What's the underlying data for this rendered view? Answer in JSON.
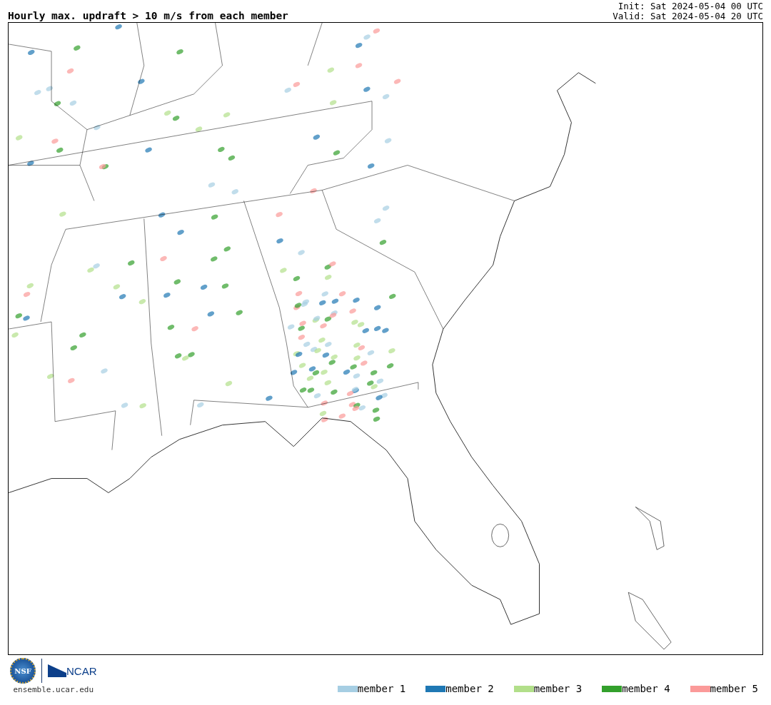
{
  "title": "Hourly max. updraft > 10 m/s from each member",
  "init": "Init: Sat 2024-05-04 00 UTC",
  "valid": "Valid: Sat 2024-05-04 20 UTC",
  "logos": {
    "nsf": "NSF",
    "ncar": "NCAR",
    "url": "ensemble.ucar.edu"
  },
  "legend": [
    {
      "label": "member 1",
      "color": "#a6cee3"
    },
    {
      "label": "member 2",
      "color": "#1f78b4"
    },
    {
      "label": "member 3",
      "color": "#b2df8a"
    },
    {
      "label": "member 4",
      "color": "#33a02c"
    },
    {
      "label": "member 5",
      "color": "#fb9a99"
    }
  ]
}
